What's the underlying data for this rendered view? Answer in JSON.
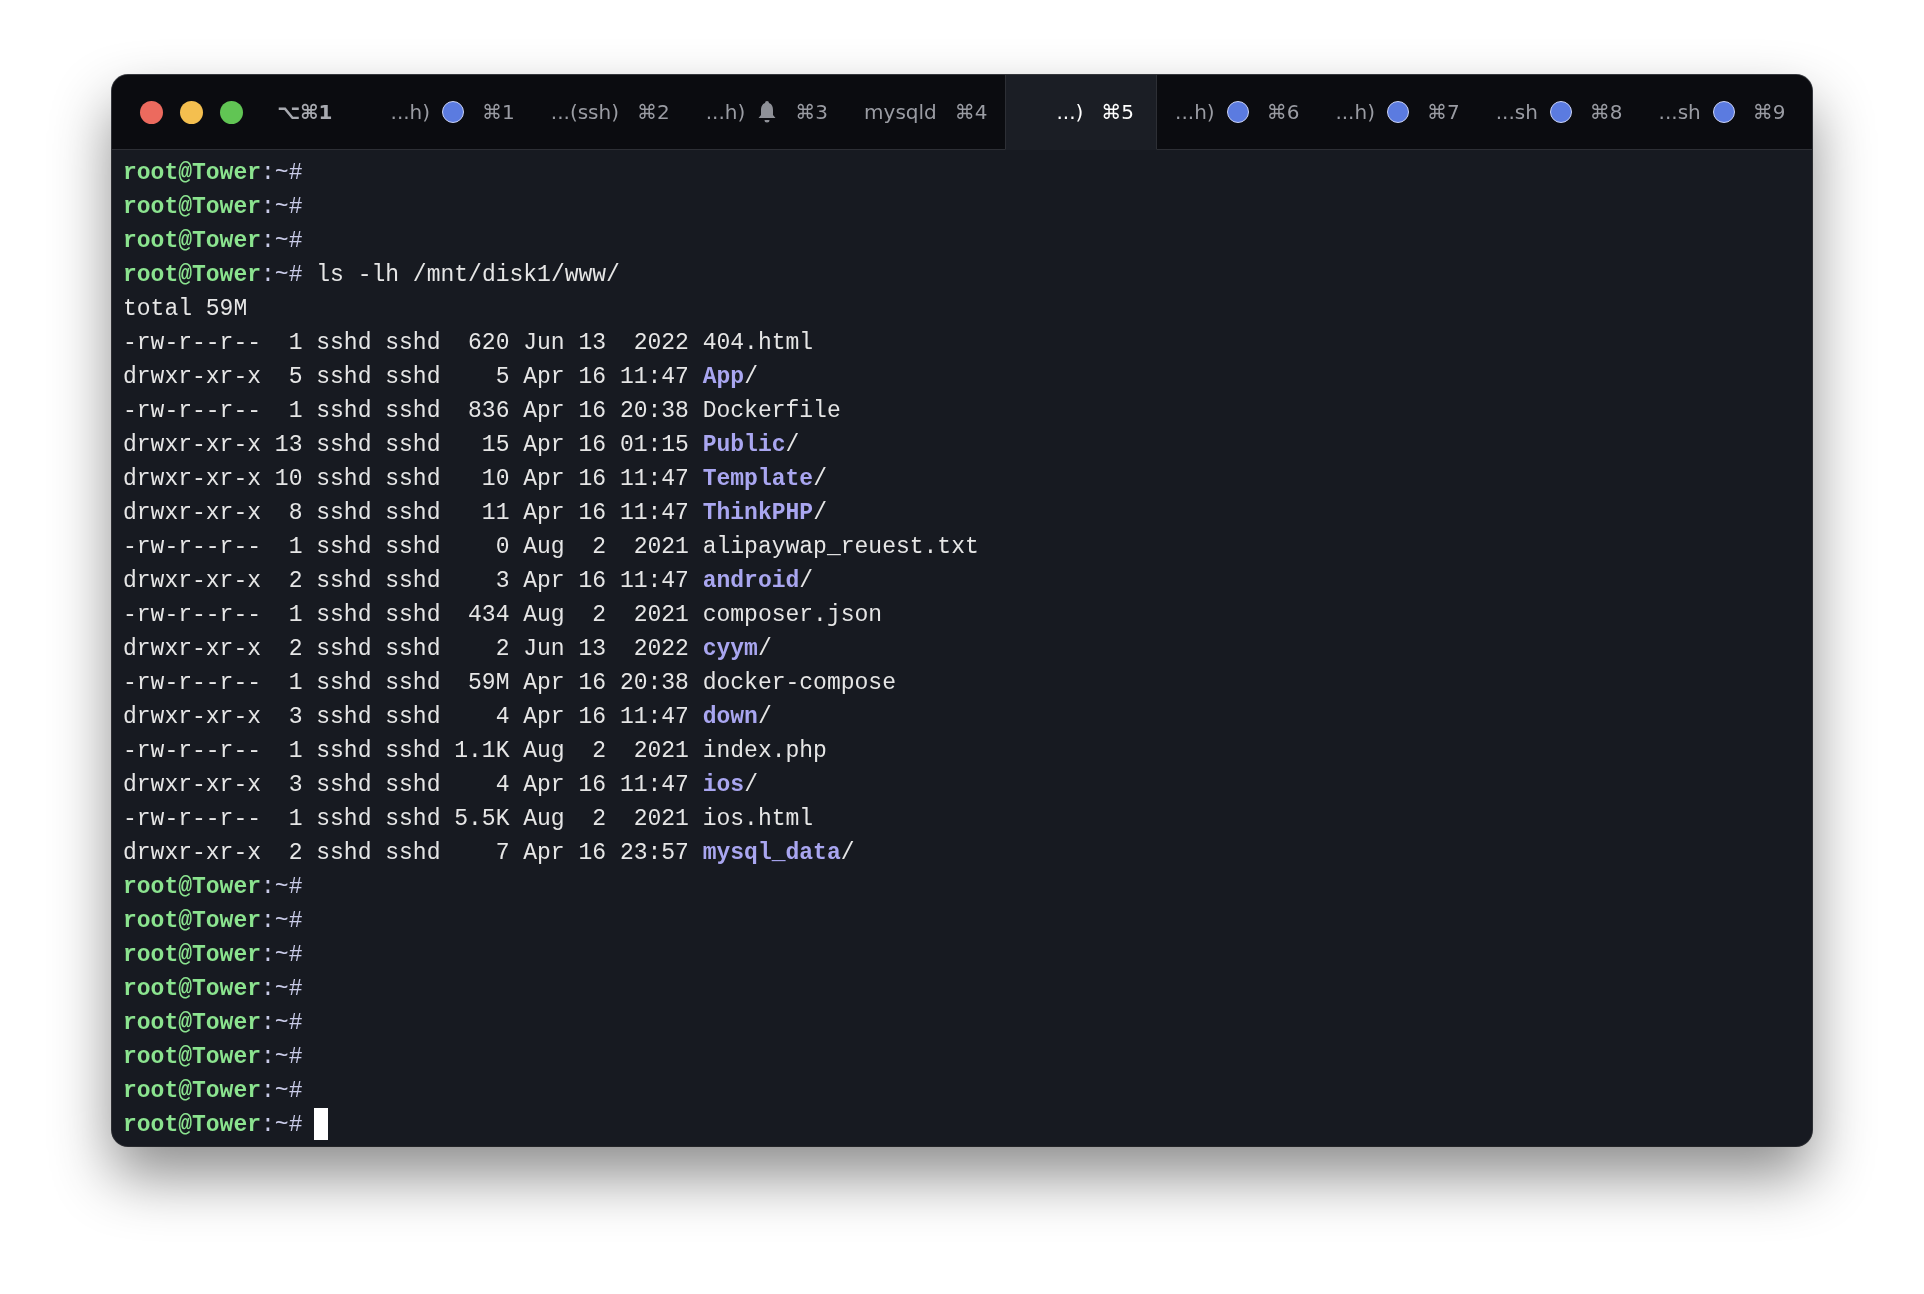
{
  "window": {
    "shortcut": "⌥⌘1"
  },
  "tabs": [
    {
      "label": "...h)",
      "kind": "dot",
      "shortcut": "⌘1",
      "selected": false
    },
    {
      "label": "...(ssh)",
      "kind": "plain",
      "shortcut": "⌘2",
      "selected": false
    },
    {
      "label": "...h)",
      "kind": "bell",
      "shortcut": "⌘3",
      "selected": false
    },
    {
      "label": "mysqld",
      "kind": "plain",
      "shortcut": "⌘4",
      "selected": false
    },
    {
      "label": "...)",
      "kind": "plain",
      "shortcut": "⌘5",
      "selected": true
    },
    {
      "label": "...h)",
      "kind": "dot",
      "shortcut": "⌘6",
      "selected": false
    },
    {
      "label": "...h)",
      "kind": "dot",
      "shortcut": "⌘7",
      "selected": false
    },
    {
      "label": "...sh",
      "kind": "dot",
      "shortcut": "⌘8",
      "selected": false
    },
    {
      "label": "...sh",
      "kind": "dot",
      "shortcut": "⌘9",
      "selected": false
    }
  ],
  "lines": [
    {
      "kind": "prompt",
      "host": "root@Tower",
      "cwd": ":~#",
      "cursor": false
    },
    {
      "kind": "prompt",
      "host": "root@Tower",
      "cwd": ":~#",
      "cursor": false
    },
    {
      "kind": "prompt",
      "host": "root@Tower",
      "cwd": ":~#",
      "cursor": false
    },
    {
      "kind": "prompt",
      "host": "root@Tower",
      "cwd": ":~#",
      "command": "ls -lh /mnt/disk1/www/",
      "cursor": false
    },
    {
      "kind": "text",
      "text": "total 59M",
      "cursor": false
    },
    {
      "kind": "file",
      "meta": "-rw-r--r--  1 sshd sshd  620 Jun 13  2022",
      "name": "404.html",
      "cursor": false
    },
    {
      "kind": "dir",
      "meta": "drwxr-xr-x  5 sshd sshd    5 Apr 16 11:47",
      "name": "App",
      "suffix": "/",
      "cursor": false
    },
    {
      "kind": "file",
      "meta": "-rw-r--r--  1 sshd sshd  836 Apr 16 20:38",
      "name": "Dockerfile",
      "cursor": false
    },
    {
      "kind": "dir",
      "meta": "drwxr-xr-x 13 sshd sshd   15 Apr 16 01:15",
      "name": "Public",
      "suffix": "/",
      "cursor": false
    },
    {
      "kind": "dir",
      "meta": "drwxr-xr-x 10 sshd sshd   10 Apr 16 11:47",
      "name": "Template",
      "suffix": "/",
      "cursor": false
    },
    {
      "kind": "dir",
      "meta": "drwxr-xr-x  8 sshd sshd   11 Apr 16 11:47",
      "name": "ThinkPHP",
      "suffix": "/",
      "cursor": false
    },
    {
      "kind": "file",
      "meta": "-rw-r--r--  1 sshd sshd    0 Aug  2  2021",
      "name": "alipaywap_reuest.txt",
      "cursor": false
    },
    {
      "kind": "dir",
      "meta": "drwxr-xr-x  2 sshd sshd    3 Apr 16 11:47",
      "name": "android",
      "suffix": "/",
      "cursor": false
    },
    {
      "kind": "file",
      "meta": "-rw-r--r--  1 sshd sshd  434 Aug  2  2021",
      "name": "composer.json",
      "cursor": false
    },
    {
      "kind": "dir",
      "meta": "drwxr-xr-x  2 sshd sshd    2 Jun 13  2022",
      "name": "cyym",
      "suffix": "/",
      "cursor": false
    },
    {
      "kind": "file",
      "meta": "-rw-r--r--  1 sshd sshd  59M Apr 16 20:38",
      "name": "docker-compose",
      "cursor": false
    },
    {
      "kind": "dir",
      "meta": "drwxr-xr-x  3 sshd sshd    4 Apr 16 11:47",
      "name": "down",
      "suffix": "/",
      "cursor": false
    },
    {
      "kind": "file",
      "meta": "-rw-r--r--  1 sshd sshd 1.1K Aug  2  2021",
      "name": "index.php",
      "cursor": false
    },
    {
      "kind": "dir",
      "meta": "drwxr-xr-x  3 sshd sshd    4 Apr 16 11:47",
      "name": "ios",
      "suffix": "/",
      "cursor": false
    },
    {
      "kind": "file",
      "meta": "-rw-r--r--  1 sshd sshd 5.5K Aug  2  2021",
      "name": "ios.html",
      "cursor": false
    },
    {
      "kind": "dir",
      "meta": "drwxr-xr-x  2 sshd sshd    7 Apr 16 23:57",
      "name": "mysql_data",
      "suffix": "/",
      "cursor": false
    },
    {
      "kind": "prompt",
      "host": "root@Tower",
      "cwd": ":~#",
      "cursor": false
    },
    {
      "kind": "prompt",
      "host": "root@Tower",
      "cwd": ":~#",
      "cursor": false
    },
    {
      "kind": "prompt",
      "host": "root@Tower",
      "cwd": ":~#",
      "cursor": false
    },
    {
      "kind": "prompt",
      "host": "root@Tower",
      "cwd": ":~#",
      "cursor": false
    },
    {
      "kind": "prompt",
      "host": "root@Tower",
      "cwd": ":~#",
      "cursor": false
    },
    {
      "kind": "prompt",
      "host": "root@Tower",
      "cwd": ":~#",
      "cursor": false
    },
    {
      "kind": "prompt",
      "host": "root@Tower",
      "cwd": ":~#",
      "cursor": false
    },
    {
      "kind": "prompt",
      "host": "root@Tower",
      "cwd": ":~#",
      "cursor": true
    }
  ]
}
